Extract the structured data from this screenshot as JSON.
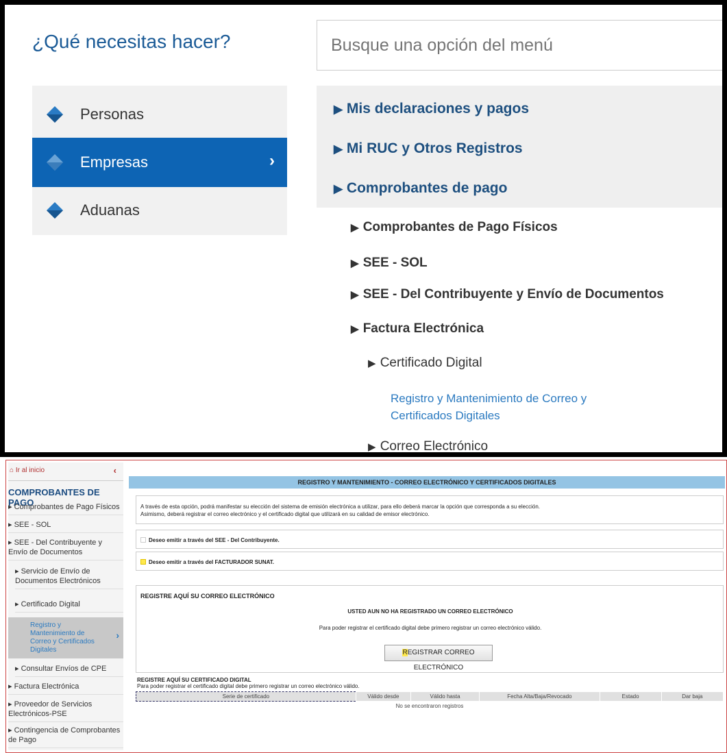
{
  "top": {
    "heading": "¿Qué necesitas hacer?",
    "search_placeholder": "Busque una opción del menú",
    "categories": [
      {
        "label": "Personas",
        "icon": "sunat-diamond-icon",
        "active": false
      },
      {
        "label": "Empresas",
        "icon": "sunat-diamond-icon",
        "active": true
      },
      {
        "label": "Aduanas",
        "icon": "sunat-diamond-icon",
        "active": false
      }
    ],
    "menu_level1": [
      "Mis declaraciones y pagos",
      "Mi RUC y Otros Registros",
      "Comprobantes de pago"
    ],
    "menu_level2": [
      "Comprobantes de Pago Físicos",
      "SEE - SOL",
      "SEE - Del Contribuyente y Envío de Documentos",
      "Factura Electrónica"
    ],
    "menu_level3": [
      "Certificado Digital",
      "Correo Electrónico"
    ],
    "menu_link": "Registro y Mantenimiento de Correo y Certificados Digitales"
  },
  "sidebar": {
    "home": "Ir al inicio",
    "title": "COMPROBANTES DE PAGO",
    "items": [
      "Comprobantes de Pago Físicos",
      "SEE - SOL",
      "SEE - Del Contribuyente y Envío de Documentos"
    ],
    "sub_items": [
      "Servicio de Envío de Documentos Electrónicos",
      "Certificado Digital"
    ],
    "active": "Registro y Mantenimiento de Correo y Certificados Digitales",
    "after_items": [
      "Consultar Envíos de CPE"
    ],
    "bottom_items": [
      "Factura Electrónica",
      "Proveedor de Servicios Electrónicos-PSE",
      "Contingencia de Comprobantes de Pago"
    ]
  },
  "content": {
    "header": "REGISTRO Y MANTENIMIENTO - CORREO ELECTRÓNICO Y CERTIFICADOS DIGITALES",
    "intro_line1": "A través de esta opción, podrá manifestar su elección del sistema de emisión electrónica a utilizar, para ello deberá marcar la opción que corresponda a su elección.",
    "intro_line2": "Asimismo, deberá registrar el correo electrónico y el certificado digital que utilizará en su calidad de emisor electrónico.",
    "option1": "Deseo emitir a través del SEE - Del Contribuyente.",
    "option2": "Deseo emitir a través del FACTURADOR SUNAT.",
    "email_section": "REGISTRE AQUÍ SU CORREO ELECTRÓNICO",
    "email_status": "USTED AUN NO HA REGISTRADO UN CORREO ELECTRÓNICO",
    "email_hint": "Para poder registrar el certificado digital debe primero registrar un correo electrónico válido.",
    "register_button_first": "R",
    "register_button_rest": "EGISTRAR CORREO ELECTRÓNICO",
    "cert_section": "REGISTRE AQUÍ SU CERTIFICADO DIGITAL",
    "cert_hint": "Para poder registrar el certificado digital debe primero registrar un correo electrónico válido.",
    "table_headers": [
      "Serie de certificado",
      "Válido desde",
      "Válido hasta",
      "Fecha Alta/Baja/Revocado",
      "Estado",
      "Dar baja"
    ],
    "no_records": "No se encontraron registros"
  },
  "colors": {
    "brand_blue": "#0d64b4",
    "header_blue": "#94c4e4",
    "link_blue": "#2b7ac0",
    "highlight": "#ffe94d"
  }
}
